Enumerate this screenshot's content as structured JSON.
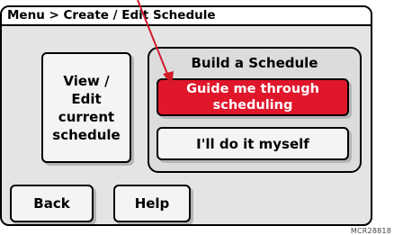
{
  "breadcrumb": "Menu > Create / Edit Schedule",
  "view_edit_label": "View / Edit current schedule",
  "build_panel": {
    "title": "Build a Schedule",
    "guide_label": "Guide me through scheduling",
    "diy_label": "I'll do it myself"
  },
  "footer": {
    "back_label": "Back",
    "help_label": "Help"
  },
  "figure_code": "MCR28818",
  "colors": {
    "accent": "#e0172b",
    "pointer_arrow": "#d11a2a",
    "screen_bg": "#e4e4e4"
  }
}
